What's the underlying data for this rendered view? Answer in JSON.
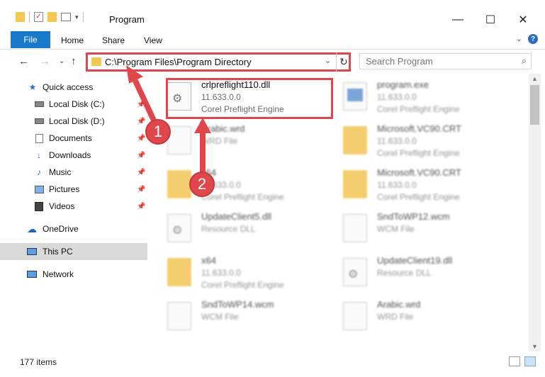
{
  "window": {
    "title": "Program",
    "minimize_glyph": "—",
    "maximize_glyph": "☐",
    "close_glyph": "✕"
  },
  "ribbon": {
    "tabs": [
      "File",
      "Home",
      "Share",
      "View"
    ]
  },
  "nav": {
    "address": "C:\\Program Files\\Program Directory",
    "search_placeholder": "Search Program"
  },
  "sidebar": {
    "items": [
      {
        "label": "Quick access",
        "icon": "star-icon",
        "pinned": false
      },
      {
        "label": "Local Disk (C:)",
        "icon": "drive-icon",
        "pinned": true
      },
      {
        "label": "Local Disk (D:)",
        "icon": "drive-icon",
        "pinned": true
      },
      {
        "label": "Documents",
        "icon": "documents-icon",
        "pinned": true
      },
      {
        "label": "Downloads",
        "icon": "download-icon",
        "pinned": true
      },
      {
        "label": "Music",
        "icon": "music-icon",
        "pinned": true
      },
      {
        "label": "Pictures",
        "icon": "pictures-icon",
        "pinned": true
      },
      {
        "label": "Videos",
        "icon": "videos-icon",
        "pinned": true
      },
      {
        "label": "OneDrive",
        "icon": "cloud-icon",
        "pinned": false
      },
      {
        "label": "This PC",
        "icon": "computer-icon",
        "pinned": false,
        "selected": true
      },
      {
        "label": "Network",
        "icon": "network-icon",
        "pinned": false
      }
    ]
  },
  "files": [
    {
      "name": "crlpreflight110.dll",
      "line1": "11.633.0.0",
      "line2": "Corel Preflight Engine",
      "icon": "dll-gear-icon",
      "highlighted": true
    },
    {
      "name": "program.exe",
      "line1": "11.633.0.0",
      "line2": "Corel Preflight Engine",
      "icon": "exe-icon"
    },
    {
      "name": "Arabic.wrd",
      "line1": "WRD File",
      "line2": "",
      "icon": "document-icon"
    },
    {
      "name": "Microsoft.VC90.CRT",
      "line1": "11.633.0.0",
      "line2": "Corel Preflight Engine",
      "icon": "folder-icon"
    },
    {
      "name": "x64",
      "line1": "11.633.0.0",
      "line2": "Corel Preflight Engine",
      "icon": "folder-icon"
    },
    {
      "name": "Microsoft.VC90.CRT",
      "line1": "11.633.0.0",
      "line2": "Corel Preflight Engine",
      "icon": "folder-icon"
    },
    {
      "name": "UpdateClient5.dll",
      "line1": "Resource DLL",
      "line2": "",
      "icon": "dll-gear-icon"
    },
    {
      "name": "SndToWP12.wcm",
      "line1": "WCM File",
      "line2": "",
      "icon": "document-icon"
    },
    {
      "name": "x64",
      "line1": "11.633.0.0",
      "line2": "Corel Preflight Engine",
      "icon": "folder-icon"
    },
    {
      "name": "UpdateClient19.dll",
      "line1": "Resource DLL",
      "line2": "",
      "icon": "dll-gear-icon"
    },
    {
      "name": "SndToWP14.wcm",
      "line1": "WCM File",
      "line2": "",
      "icon": "document-icon"
    },
    {
      "name": "Arabic.wrd",
      "line1": "WRD File",
      "line2": "",
      "icon": "document-icon"
    }
  ],
  "status": {
    "item_count": "177 items"
  },
  "callouts": [
    "1",
    "2"
  ],
  "colors": {
    "accent": "#1979ca",
    "highlight": "#e0474c"
  }
}
